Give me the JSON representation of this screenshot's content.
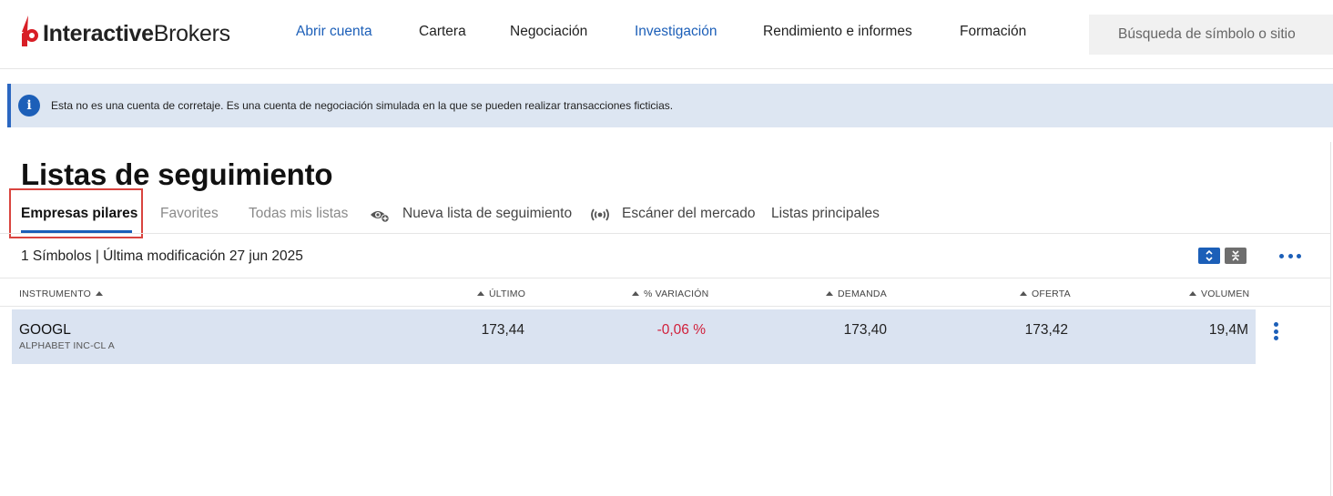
{
  "brand": {
    "name_bold": "Interactive",
    "name_light": "Brokers",
    "accent": "#d81e26"
  },
  "nav": {
    "items": [
      {
        "label": "Abrir cuenta"
      },
      {
        "label": "Cartera"
      },
      {
        "label": "Negociación"
      },
      {
        "label": "Investigación"
      },
      {
        "label": "Rendimiento e informes"
      },
      {
        "label": "Formación"
      }
    ]
  },
  "search": {
    "placeholder": "Búsqueda de símbolo o sitio"
  },
  "banner": {
    "icon": "info-icon",
    "text": "Esta no es una cuenta de corretaje. Es una cuenta de negociación simulada en la que se pueden realizar transacciones ficticias."
  },
  "page": {
    "title": "Listas de seguimiento"
  },
  "tabs": [
    {
      "label": "Empresas pilares"
    },
    {
      "label": "Favorites"
    },
    {
      "label": "Todas mis listas"
    },
    {
      "label": "Nueva lista de seguimiento",
      "icon": "eye-plus-icon"
    },
    {
      "label": "Escáner del mercado",
      "icon": "scanner-icon"
    },
    {
      "label": "Listas principales"
    }
  ],
  "summary": {
    "text": "1 Símbolos | Última modificación 27 jun 2025"
  },
  "table": {
    "columns": [
      "INSTRUMENTO",
      "ÚLTIMO",
      "% VARIACIÓN",
      "DEMANDA",
      "OFERTA",
      "VOLUMEN"
    ],
    "rows": [
      {
        "symbol": "GOOGL",
        "description": "ALPHABET INC-CL A",
        "last": "173,44",
        "change": "-0,06 %",
        "bid": "173,40",
        "ask": "173,42",
        "volume": "19,4M"
      }
    ]
  },
  "colors": {
    "primary_blue": "#1c5fb8",
    "negative_red": "#d11f3a",
    "row_highlight": "#dae3f1",
    "banner_bg": "#dde6f2"
  }
}
